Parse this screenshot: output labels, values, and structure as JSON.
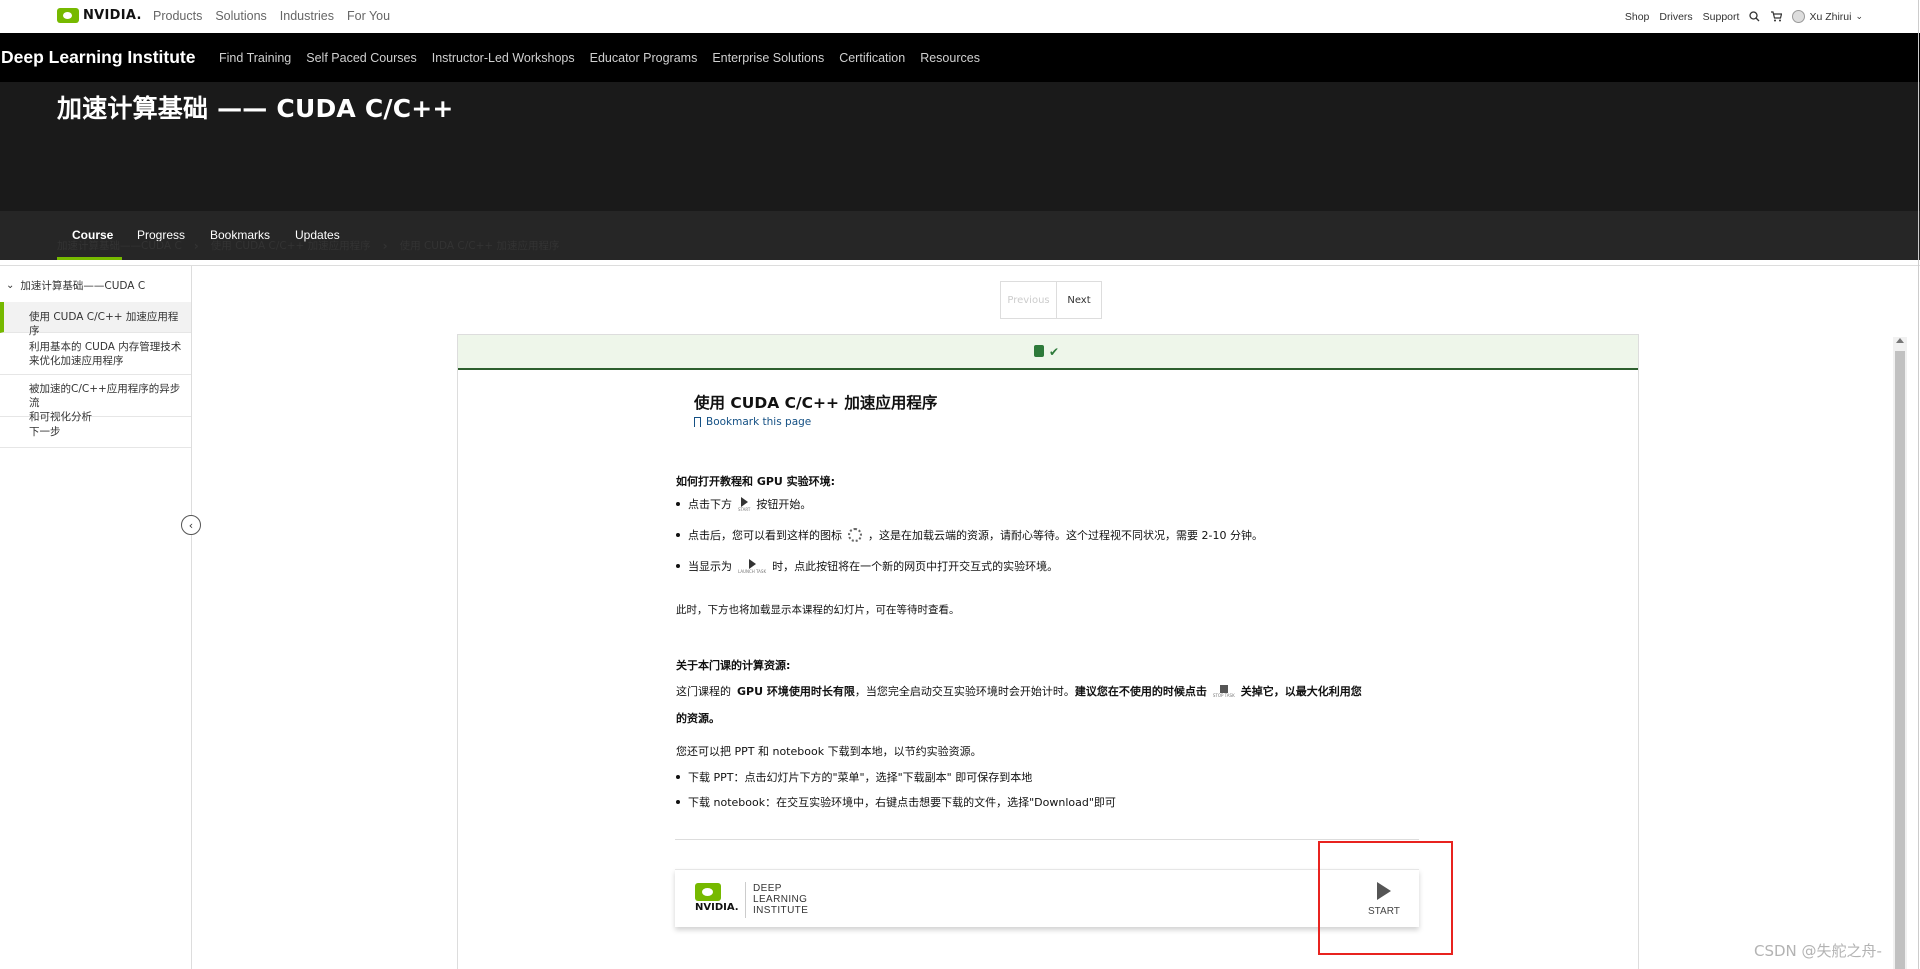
{
  "topnav": {
    "brand": "NVIDIA.",
    "links": [
      "Products",
      "Solutions",
      "Industries",
      "For You"
    ],
    "right": [
      "Shop",
      "Drivers",
      "Support"
    ],
    "user": "Xu Zhirui"
  },
  "dli": {
    "brand": "Deep Learning Institute",
    "links": [
      "Find Training",
      "Self Paced Courses",
      "Instructor-Led Workshops",
      "Educator Programs",
      "Enterprise Solutions",
      "Certification",
      "Resources"
    ],
    "course_title": "加速计算基础 —— CUDA C/C++",
    "tabs": [
      "Course",
      "Progress",
      "Bookmarks",
      "Updates"
    ]
  },
  "breadcrumb": [
    "加速计算基础——CUDA C",
    "使用 CUDA C/C++ 加速应用程序",
    "使用 CUDA C/C++ 加速应用程序"
  ],
  "sidebar": {
    "section": "加速计算基础——CUDA C",
    "items": [
      {
        "line1": "使用 CUDA C/C++ 加速应用程序",
        "line2": ""
      },
      {
        "line1": "利用基本的 CUDA 内存管理技术",
        "line2": "来优化加速应用程序"
      },
      {
        "line1": "被加速的C/C++应用程序的异步流",
        "line2": "和可视化分析"
      },
      {
        "line1": "下一步",
        "line2": ""
      }
    ]
  },
  "pager": {
    "prev": "Previous",
    "next": "Next"
  },
  "content": {
    "title": "使用 CUDA C/C++ 加速应用程序",
    "bookmark": "Bookmark this page",
    "h1": "如何打开教程和 GPU 实验环境:",
    "b1_pre": "点击下方",
    "b1_icon": "START",
    "b1_post": "按钮开始。",
    "b2_pre": "点击后，您可以看到这样的图标",
    "b2_post": "，这是在加载云端的资源，请耐心等待。这个过程视不同状况，需要 2-10 分钟。",
    "b3_pre": "当显示为",
    "b3_icon": "LAUNCH TASK",
    "b3_post": "时，点此按钮将在一个新的网页中打开交互式的实验环境。",
    "p1": "此时，下方也将加载显示本课程的幻灯片，可在等待时查看。",
    "h2": "关于本门课的计算资源:",
    "p2_a": "这门课程的",
    "p2_b": "GPU 环境使用时长有限",
    "p2_c": "，当您完全启动交互实验环境时会开始计时。",
    "p2_d": "建议您在不使用的时候点击",
    "p2_icon": "STOP TASK",
    "p2_e": "关掉它，以最大化利用您",
    "p2_f": "的资源。",
    "p3": "您还可以把 PPT 和 notebook 下载到本地，以节约实验资源。",
    "b4": "下载 PPT：点击幻灯片下方的\"菜单\"，选择\"下载副本\" 即可保存到本地",
    "b5": "下载 notebook：在交互实验环境中，右键点击想要下载的文件，选择\"Download\"即可"
  },
  "launcher": {
    "nvidia": "NVIDIA.",
    "dli_l1": "DEEP",
    "dli_l2": "LEARNING",
    "dli_l3": "INSTITUTE",
    "start": "START"
  },
  "watermark": "CSDN @失舵之舟-",
  "colors": {
    "accent": "#76b900",
    "highlight": "#e8231f",
    "header": "#000000"
  }
}
